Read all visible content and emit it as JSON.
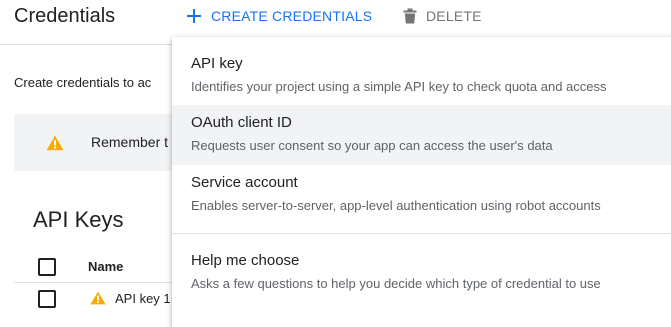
{
  "header": {
    "title": "Credentials",
    "create_label": "CREATE CREDENTIALS",
    "delete_label": "DELETE"
  },
  "main": {
    "intro_text": "Create credentials to ac",
    "notice_text": "Remember t",
    "api_keys": {
      "title": "API Keys",
      "column_name": "Name",
      "rows": [
        {
          "name": "API key 1",
          "status_icon": "warning-icon"
        }
      ]
    }
  },
  "menu": {
    "items": [
      {
        "title": "API key",
        "description": "Identifies your project using a simple API key to check quota and access"
      },
      {
        "title": "OAuth client ID",
        "description": "Requests user consent so your app can access the user's data"
      },
      {
        "title": "Service account",
        "description": "Enables server-to-server, app-level authentication using robot accounts"
      },
      {
        "title": "Help me choose",
        "description": "Asks a few questions to help you decide which type of credential to use"
      }
    ]
  },
  "colors": {
    "accent": "#1a73e8",
    "warning": "#f9ab00",
    "text_primary": "#202124",
    "text_secondary": "#5f6368",
    "hover": "#f1f3f4"
  },
  "icons": [
    "plus-icon",
    "trash-icon",
    "warning-icon"
  ]
}
